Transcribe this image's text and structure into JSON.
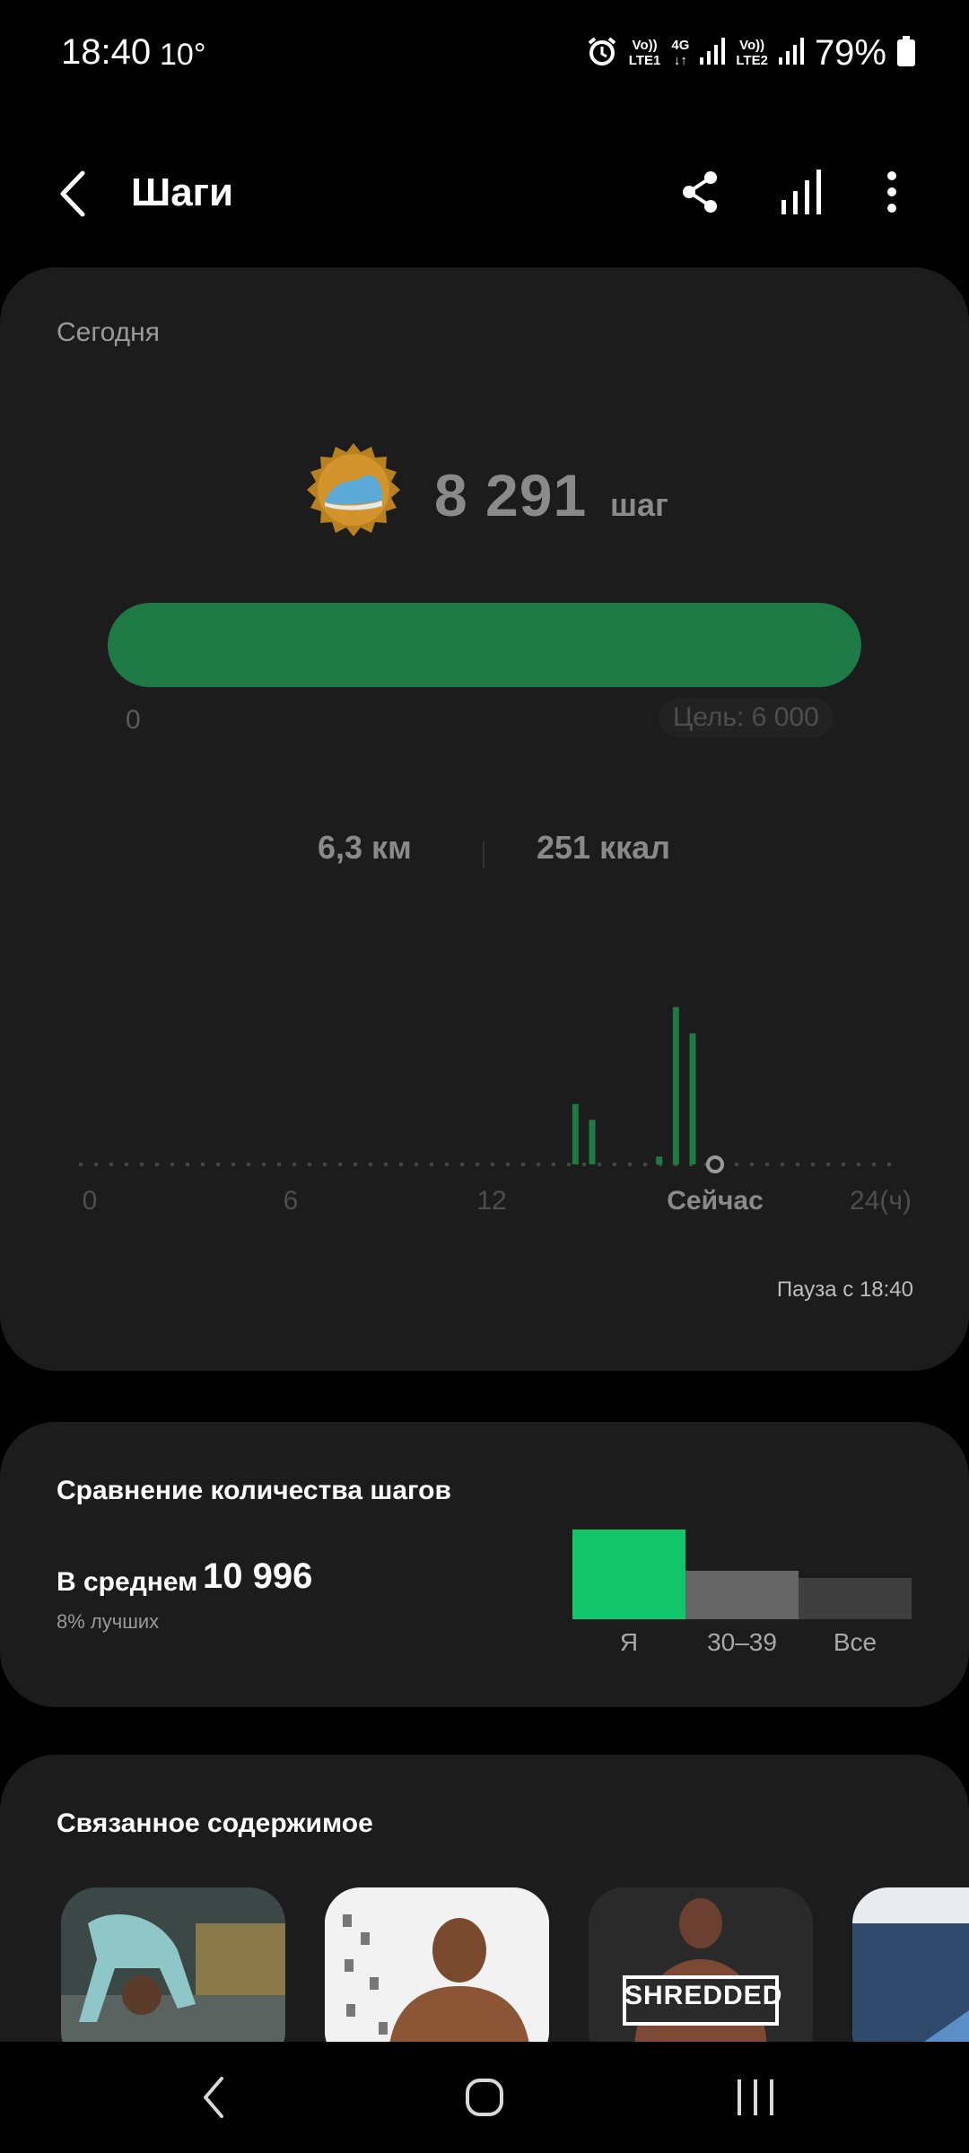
{
  "status_bar": {
    "time": "18:40",
    "temperature": "10°",
    "sim1_top": "Vo))",
    "sim1_bottom": "LTE1",
    "net": "4G",
    "sim2_top": "Vo))",
    "sim2_bottom": "LTE2",
    "battery": "79%"
  },
  "header": {
    "title": "Шаги"
  },
  "today_card": {
    "label": "Сегодня",
    "steps_value": "8 291",
    "steps_unit": "шаг",
    "progress_fraction": 1.0,
    "progress_start": "0",
    "goal": "Цель: 6 000",
    "distance": "6,3 км",
    "calories": "251 ккал",
    "pause_text": "Пауза с 18:40",
    "accent_color": "#1e7a45"
  },
  "chart_data": {
    "type": "bar",
    "x_ticks": [
      "0",
      "6",
      "12",
      "Сейчас",
      "24(ч)"
    ],
    "xlim": [
      0,
      24
    ],
    "now_hour": 18.67,
    "bars": [
      {
        "hour": 14.5,
        "value": 46
      },
      {
        "hour": 15.0,
        "value": 34
      },
      {
        "hour": 17.0,
        "value": 6
      },
      {
        "hour": 17.5,
        "value": 120
      },
      {
        "hour": 18.0,
        "value": 100
      }
    ],
    "ylim": [
      0,
      130
    ]
  },
  "compare_card": {
    "title": "Сравнение количества шагов",
    "avg_label": "В среднем",
    "avg_value": "10 996",
    "percentile": "8% лучших",
    "groups": [
      {
        "label": "Я",
        "value": 100,
        "color": "#13c56a"
      },
      {
        "label": "30–39",
        "value": 54,
        "color": "#666666"
      },
      {
        "label": "Все",
        "value": 46,
        "color": "#3f3f3f"
      }
    ]
  },
  "related_card": {
    "title": "Связанное содержимое",
    "items": [
      {
        "name": "stretch-workout"
      },
      {
        "name": "muscle-workout"
      },
      {
        "name": "shredded-workout",
        "label": "SHREDDED"
      },
      {
        "name": "sofa-workout"
      }
    ]
  }
}
